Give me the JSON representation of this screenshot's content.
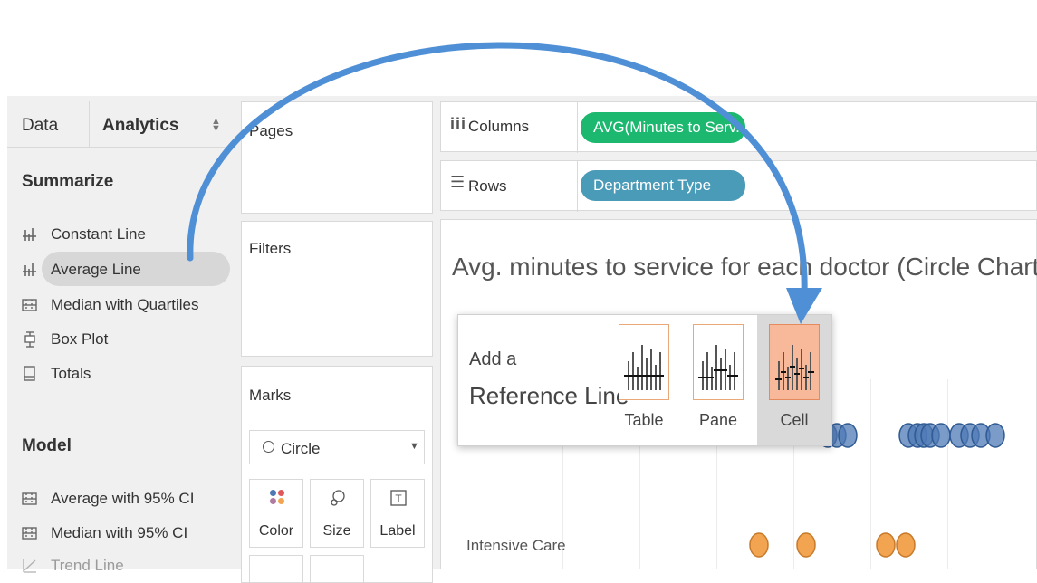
{
  "left_pane": {
    "tabs": [
      {
        "label": "Data"
      },
      {
        "label": "Analytics"
      }
    ],
    "summarize": {
      "title": "Summarize",
      "items": [
        {
          "label": "Constant Line",
          "icon": "constant-line-icon"
        },
        {
          "label": "Average Line",
          "icon": "average-line-icon"
        },
        {
          "label": "Median with Quartiles",
          "icon": "median-quartiles-icon"
        },
        {
          "label": "Box Plot",
          "icon": "box-plot-icon"
        },
        {
          "label": "Totals",
          "icon": "totals-icon"
        }
      ]
    },
    "model": {
      "title": "Model",
      "items": [
        {
          "label": "Average with 95% CI",
          "icon": "average-ci-icon"
        },
        {
          "label": "Median with 95% CI",
          "icon": "median-ci-icon"
        },
        {
          "label": "Trend Line",
          "icon": "trend-line-icon"
        }
      ]
    }
  },
  "middle_pane": {
    "pages_label": "Pages",
    "filters_label": "Filters",
    "marks_label": "Marks",
    "mark_type": "Circle",
    "mark_buttons": [
      {
        "label": "Color",
        "icon": "color-icon"
      },
      {
        "label": "Size",
        "icon": "size-icon"
      },
      {
        "label": "Label",
        "icon": "label-icon"
      }
    ]
  },
  "shelves": {
    "columns_label": "Columns",
    "columns_pill": "AVG(Minutes to Serv..",
    "rows_label": "Rows",
    "rows_pill": "Department Type"
  },
  "view": {
    "title": "Avg. minutes to service for each doctor (Circle Chart)",
    "row_labels": [
      "Intensive Care"
    ]
  },
  "popup": {
    "line1": "Add a",
    "line2": "Reference Line",
    "options": [
      {
        "label": "Table",
        "selected": false
      },
      {
        "label": "Pane",
        "selected": false
      },
      {
        "label": "Cell",
        "selected": true
      }
    ]
  },
  "colors": {
    "columns_pill": "#1cb86f",
    "rows_pill": "#4a9bb8",
    "blue_mark": "#4f79b5",
    "orange_mark": "#f2a451",
    "arrow": "#4f8fd6",
    "cell_highlight": "#f8b99a"
  }
}
